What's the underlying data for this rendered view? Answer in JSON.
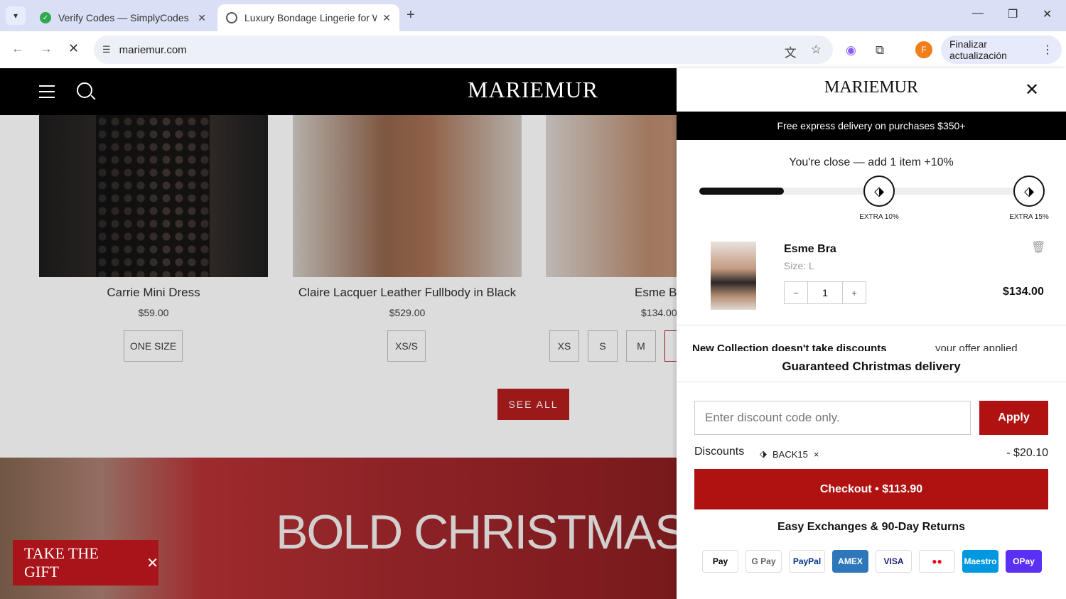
{
  "browser": {
    "tabs": [
      {
        "title": "Verify Codes — SimplyCodes",
        "favicon_color": "#2fa84f"
      },
      {
        "title": "Luxury Bondage Lingerie for Wo",
        "favicon_color": "#555555"
      }
    ],
    "url": "mariemur.com",
    "profile_initial": "F",
    "update_label": "Finalizar actualización"
  },
  "page": {
    "logo": "MARIEMUR",
    "products": [
      {
        "name": "Carrie Mini Dress",
        "price": "$59.00",
        "sizes": [
          "ONE SIZE"
        ]
      },
      {
        "name": "Claire Lacquer Leather Fullbody in Black",
        "price": "$529.00",
        "sizes": [
          "XS/S"
        ]
      },
      {
        "name": "Esme Br",
        "price": "$134.00",
        "sizes": [
          "XS",
          "S",
          "M",
          "L"
        ]
      }
    ],
    "see_all_label": "SEE ALL",
    "banner_title": "BOLD CHRISTMAS C",
    "gift_label": "TAKE THE GIFT",
    "gift_close": "✕"
  },
  "cart": {
    "logo": "MARIEMUR",
    "promo_text": "Free express delivery on purchases $350+",
    "progress_message": "You're close — add 1 item +10%",
    "progress_fraction": 0.255,
    "tiers": [
      {
        "label": "EXTRA 10%"
      },
      {
        "label": "EXTRA 15%"
      }
    ],
    "item": {
      "name": "Esme Bra",
      "size": "Size: L",
      "quantity": "1",
      "price": "$134.00"
    },
    "cut_text_left": "New Collection doesn't take discounts",
    "cut_text_right": "your offer applied",
    "guaranteed": "Guaranteed Christmas delivery",
    "discount_placeholder": "Enter discount code only.",
    "apply_label": "Apply",
    "discounts_label": "Discounts",
    "discount_code": "BACK15",
    "discount_remove": "×",
    "discount_amount": "- $20.10",
    "checkout_label": "Checkout • $113.90",
    "returns_label": "Easy Exchanges & 90-Day Returns",
    "payments": [
      {
        "label": "Pay",
        "color": "#000000"
      },
      {
        "label": "G Pay",
        "color": "#5f6368"
      },
      {
        "label": "PayPal",
        "color": "#003087"
      },
      {
        "label": "AMEX",
        "color": "#ffffff",
        "bg": "#2e77bb"
      },
      {
        "label": "VISA",
        "color": "#1a1f71"
      },
      {
        "label": "●●",
        "color": "#eb001b"
      },
      {
        "label": "Maestro",
        "color": "#ffffff",
        "bg": "#0099df"
      },
      {
        "label": "OPay",
        "color": "#ffffff",
        "bg": "#5a31f4"
      }
    ]
  }
}
